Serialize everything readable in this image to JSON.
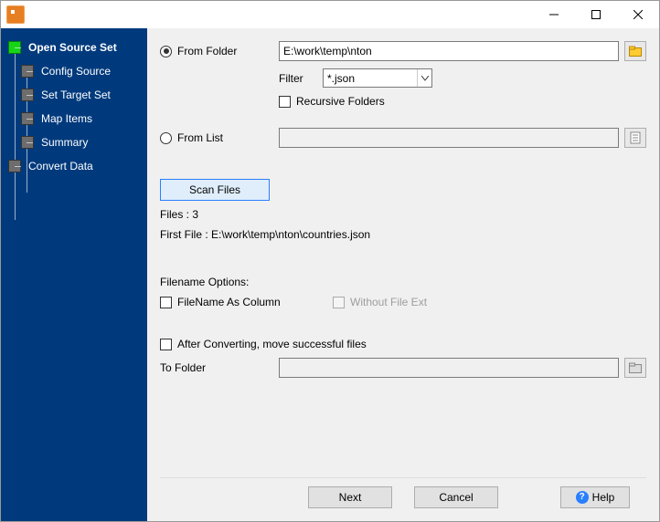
{
  "sidebar": {
    "items": [
      {
        "label": "Open Source Set",
        "active": true
      },
      {
        "label": "Config Source"
      },
      {
        "label": "Set Target Set"
      },
      {
        "label": "Map Items"
      },
      {
        "label": "Summary"
      },
      {
        "label": "Convert Data"
      }
    ]
  },
  "source": {
    "from_folder_label": "From Folder",
    "folder_value": "E:\\work\\temp\\nton",
    "filter_label": "Filter",
    "filter_value": "*.json",
    "recursive_label": "Recursive Folders",
    "from_list_label": "From List",
    "list_value": ""
  },
  "scan": {
    "button": "Scan Files",
    "files_label": "Files : 3",
    "first_file_label": "First File : E:\\work\\temp\\nton\\countries.json"
  },
  "filename": {
    "options_label": "Filename Options:",
    "as_column_label": "FileName As Column",
    "without_ext_label": "Without File Ext"
  },
  "after": {
    "move_label": "After Converting, move successful files",
    "to_folder_label": "To Folder",
    "to_folder_value": ""
  },
  "footer": {
    "next": "Next",
    "cancel": "Cancel",
    "help": "Help"
  }
}
